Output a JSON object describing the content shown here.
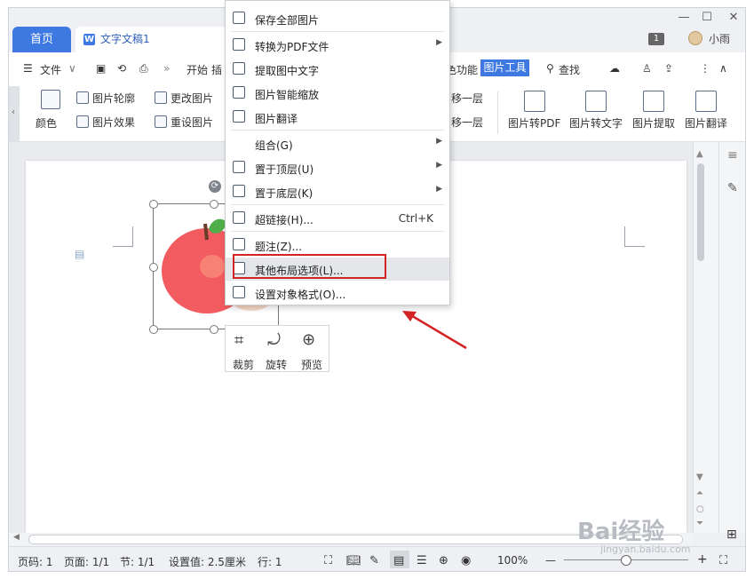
{
  "titlebar": {
    "home_tab": "首页",
    "doc_tab": "文字文稿1",
    "badge": "1",
    "user": "小雨"
  },
  "menurow": {
    "file": "文件",
    "start": "开始",
    "insert_partial": "插",
    "func_partial": "色功能",
    "picture_tools": "图片工具",
    "search": "查找"
  },
  "ribbon": {
    "outline": "图片轮廓",
    "change_pic": "更改图片",
    "color": "颜色",
    "effect": "图片效果",
    "reset_pic": "重设图片",
    "move_up": "移一层",
    "move_down": "移一层",
    "pic_to_pdf": "图片转PDF",
    "pic_to_text": "图片转文字",
    "pic_extract": "图片提取",
    "pic_translate": "图片翻译"
  },
  "context_menu": {
    "items": [
      {
        "label": "保存全部图片",
        "icon": "save-images-icon"
      },
      {
        "label": "转换为PDF文件",
        "icon": "pdf-icon",
        "submenu": true
      },
      {
        "label": "提取图中文字",
        "icon": "ocr-icon"
      },
      {
        "label": "图片智能缩放",
        "icon": "smart-scale-icon"
      },
      {
        "label": "图片翻译",
        "icon": "translate-icon"
      },
      {
        "label": "组合(G)",
        "submenu": true
      },
      {
        "label": "置于顶层(U)",
        "icon": "bring-front-icon",
        "submenu": true
      },
      {
        "label": "置于底层(K)",
        "icon": "send-back-icon",
        "submenu": true
      },
      {
        "label": "超链接(H)...",
        "icon": "link-icon",
        "shortcut": "Ctrl+K"
      },
      {
        "label": "题注(Z)...",
        "icon": "caption-icon"
      },
      {
        "label": "其他布局选项(L)...",
        "icon": "layout-icon",
        "highlighted": true
      },
      {
        "label": "设置对象格式(O)...",
        "icon": "format-object-icon"
      }
    ]
  },
  "float_toolbar": {
    "crop": "裁剪",
    "rotate": "旋转",
    "preview": "预览"
  },
  "statusbar": {
    "page_code": "页码: 1",
    "pages": "页面: 1/1",
    "section": "节: 1/1",
    "setting": "设置值: 2.5厘米",
    "row": "行: 1",
    "zoom": "100%"
  },
  "watermark": {
    "brand": "Bai经验",
    "url": "jingyan.baidu.com"
  },
  "colors": {
    "accent": "#3d79e0",
    "highlight_border": "#d42323",
    "arrow": "#d42323"
  }
}
